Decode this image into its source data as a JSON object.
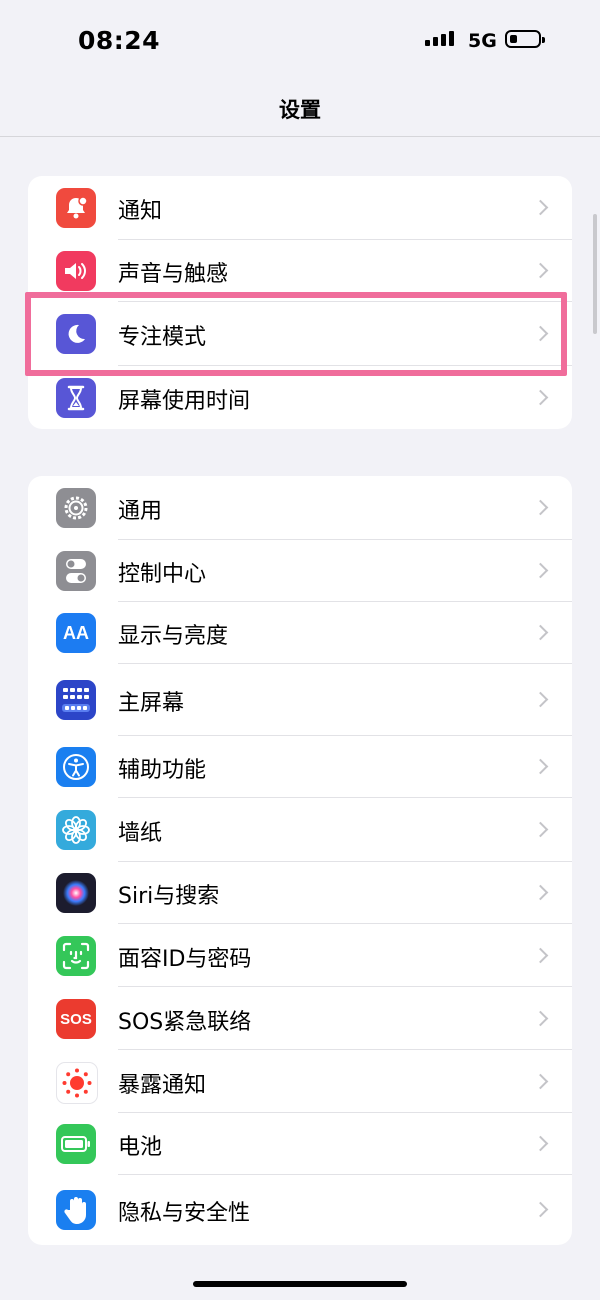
{
  "status_bar": {
    "time": "08:24",
    "network": "5G"
  },
  "nav": {
    "title": "设置"
  },
  "groups": [
    {
      "items": [
        {
          "label": "通知",
          "icon": "bell-icon",
          "color": "#f04a3e"
        },
        {
          "label": "声音与触感",
          "icon": "speaker-icon",
          "color": "#f13a5f"
        },
        {
          "label": "专注模式",
          "icon": "moon-icon",
          "color": "#5856d6"
        },
        {
          "label": "屏幕使用时间",
          "icon": "hourglass-icon",
          "color": "#5856d6"
        }
      ]
    },
    {
      "items": [
        {
          "label": "通用",
          "icon": "gear-icon",
          "color": "#8e8e93"
        },
        {
          "label": "控制中心",
          "icon": "toggles-icon",
          "color": "#8e8e93"
        },
        {
          "label": "显示与亮度",
          "icon": "aa-icon",
          "color": "#1c7cf2",
          "icon_text": "AA"
        },
        {
          "label": "主屏幕",
          "icon": "home-grid-icon",
          "color": "#2c45c8"
        },
        {
          "label": "辅助功能",
          "icon": "accessibility-icon",
          "color": "#1a7ff0"
        },
        {
          "label": "墙纸",
          "icon": "flower-icon",
          "color": "#34aadc"
        },
        {
          "label": "Siri与搜索",
          "icon": "siri-icon",
          "color": "#1c1c2e"
        },
        {
          "label": "面容ID与密码",
          "icon": "face-id-icon",
          "color": "#34c759"
        },
        {
          "label": "SOS紧急联络",
          "icon": "sos-icon",
          "color": "#eb3b2f",
          "icon_text": "SOS"
        },
        {
          "label": "暴露通知",
          "icon": "exposure-icon",
          "color": "#ffffff"
        },
        {
          "label": "电池",
          "icon": "battery-icon",
          "color": "#34c759"
        },
        {
          "label": "隐私与安全性",
          "icon": "hand-icon",
          "color": "#1a7ff0"
        }
      ]
    }
  ],
  "highlighted_item": "专注模式"
}
